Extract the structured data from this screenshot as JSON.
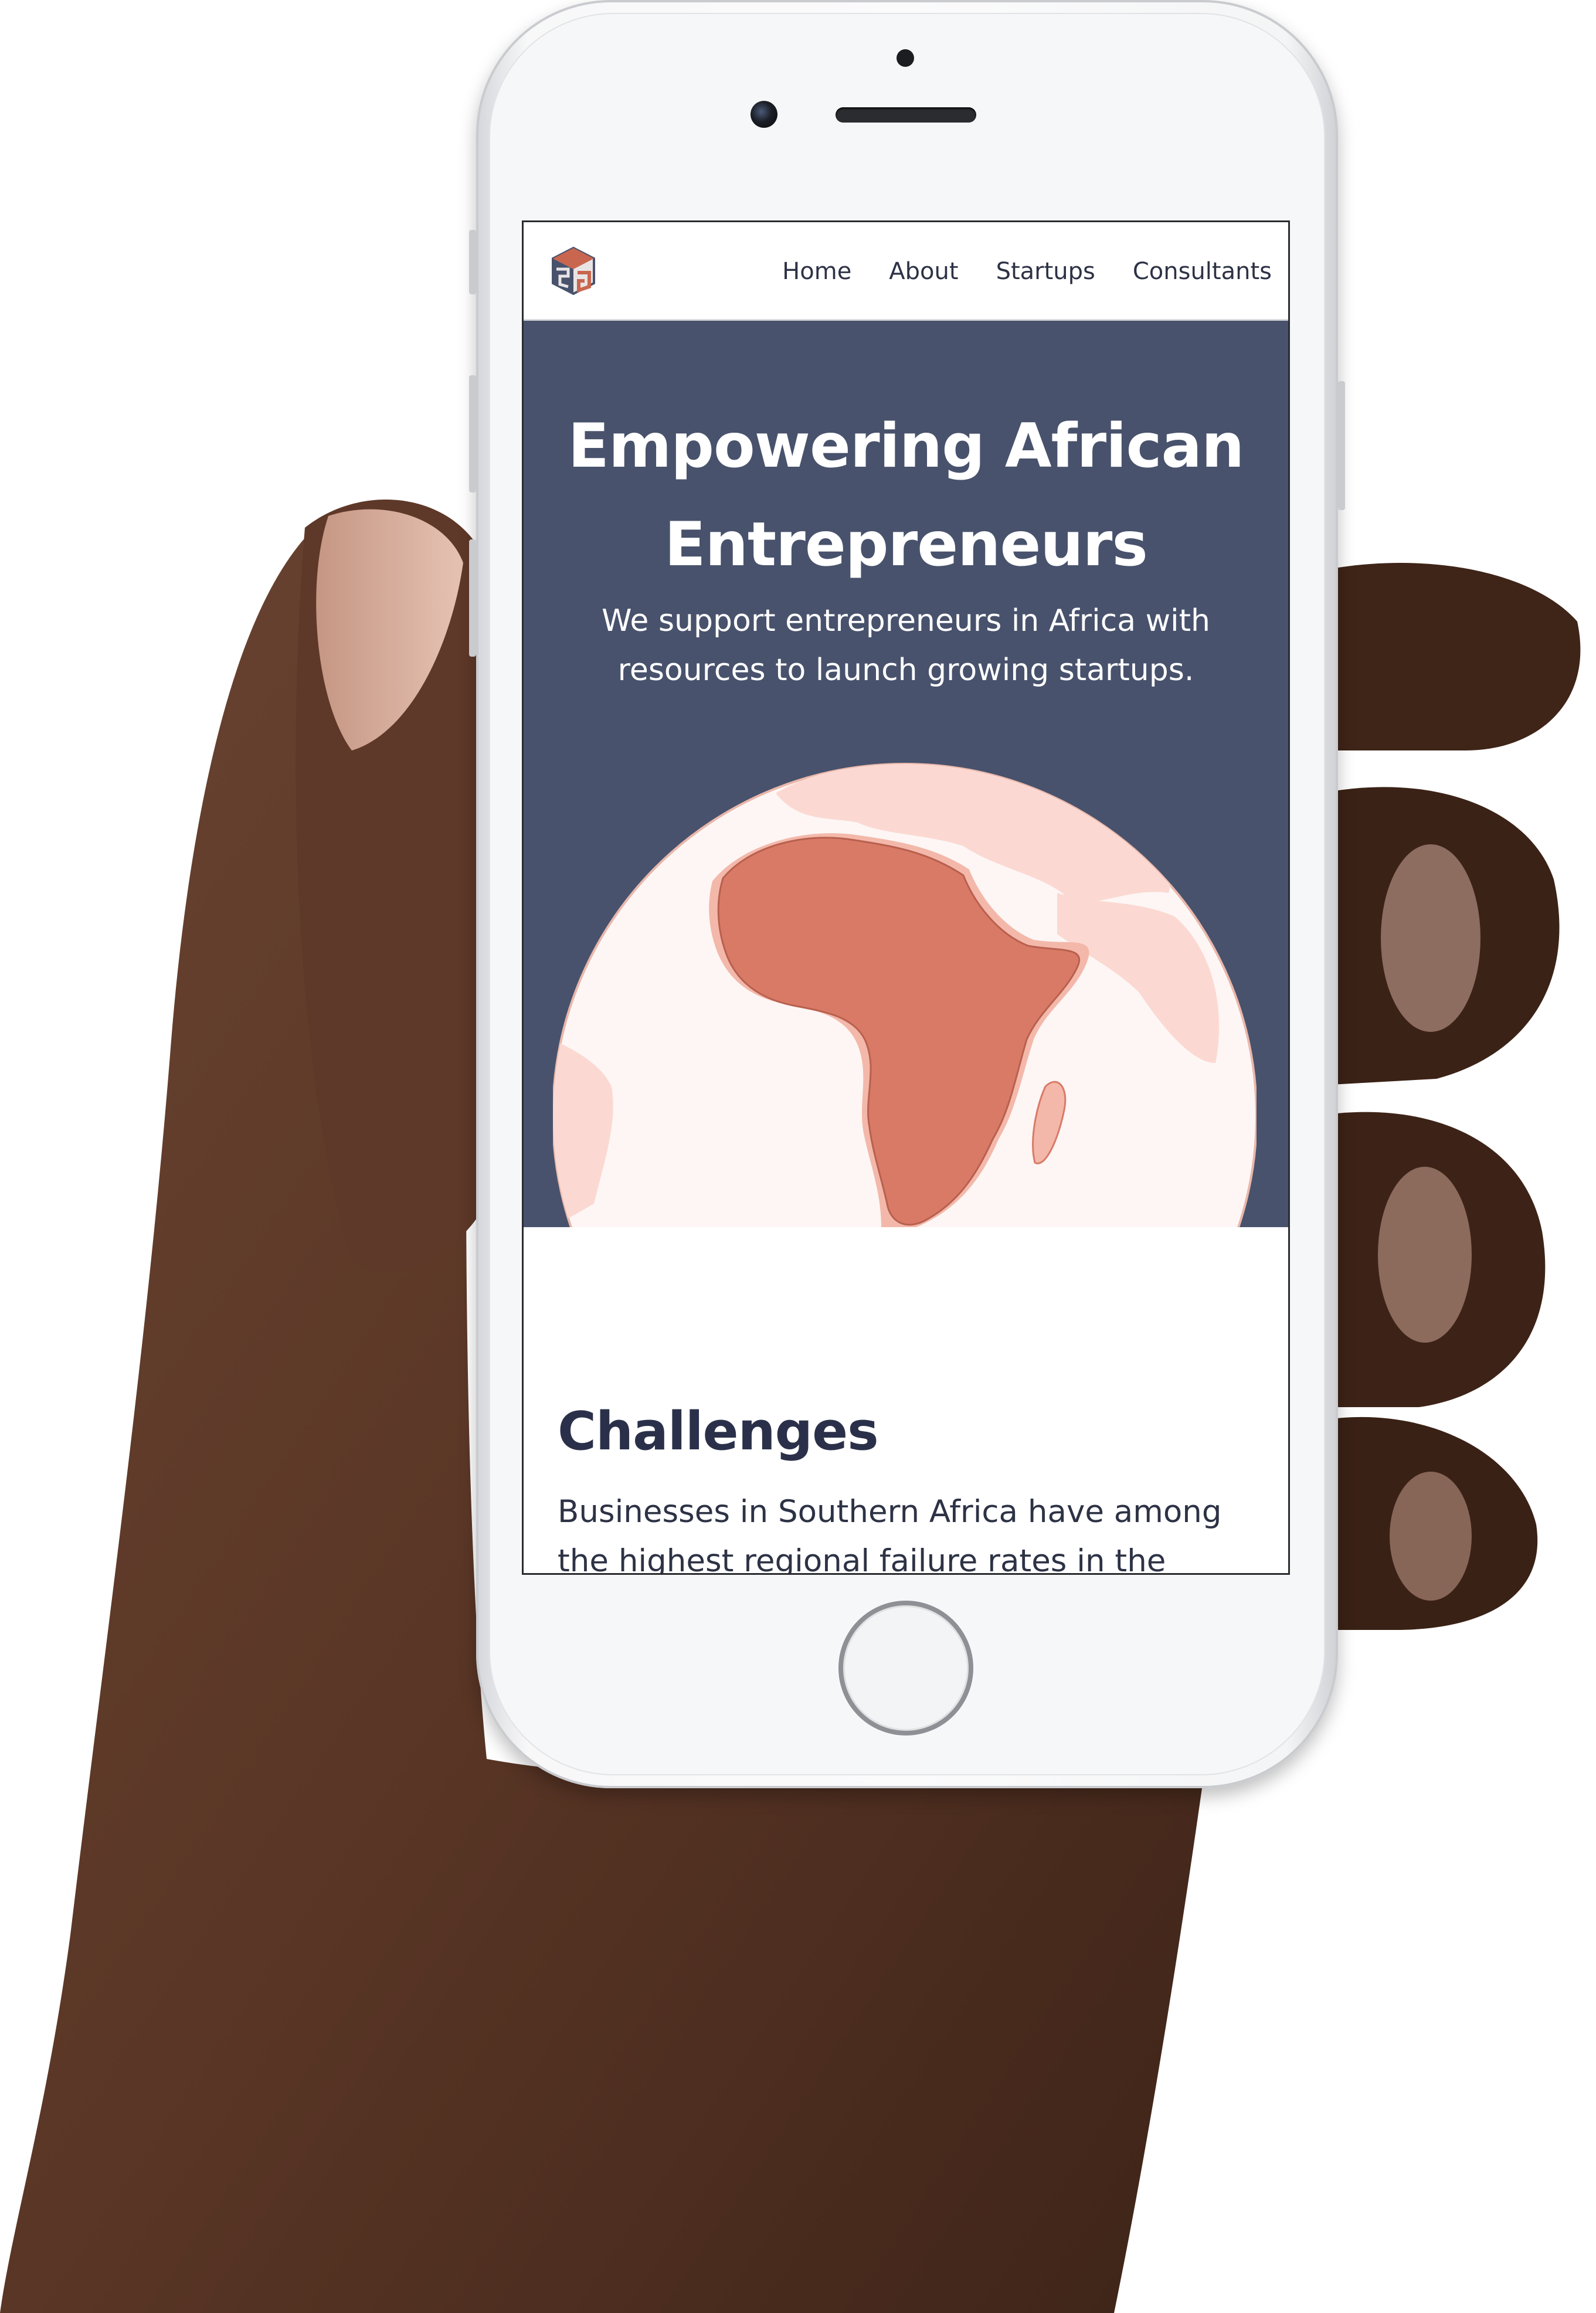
{
  "nav": {
    "logo": "logo-icon",
    "links": [
      "Home",
      "About",
      "Startups",
      "Consultants"
    ]
  },
  "hero": {
    "title": "Empowering African Entrepreneurs",
    "subtitle": "We support entrepreneurs in Africa with resources to launch growing startups.",
    "illustration": "globe-africa-icon"
  },
  "challenges": {
    "title": "Challenges",
    "text": "Businesses in Southern Africa have among the highest regional failure rates in the"
  },
  "colors": {
    "hero_bg": "#48526c",
    "heading": "#2b304a",
    "globe_land": "#d97a67",
    "globe_ocean": "#fdf6f4"
  }
}
